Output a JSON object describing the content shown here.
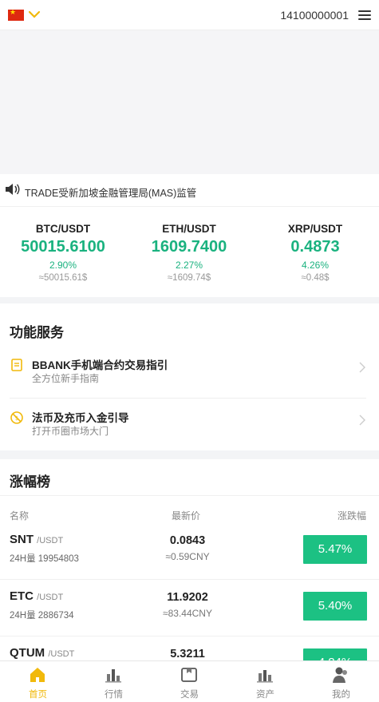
{
  "header": {
    "flag_icon": "china-flag-icon",
    "dropdown_icon": "chevron-down-icon",
    "phone": "14100000001",
    "menu_icon": "hamburger-menu-icon"
  },
  "notice": {
    "icon": "speaker-icon",
    "text": "TRADE受新加坡金融管理局(MAS)监管"
  },
  "tickers": [
    {
      "pair": "BTC/USDT",
      "price": "50015.6100",
      "change": "2.90%",
      "approx": "≈50015.61$"
    },
    {
      "pair": "ETH/USDT",
      "price": "1609.7400",
      "change": "2.27%",
      "approx": "≈1609.74$"
    },
    {
      "pair": "XRP/USDT",
      "price": "0.4873",
      "change": "4.26%",
      "approx": "≈0.48$"
    }
  ],
  "services": {
    "title": "功能服务",
    "items": [
      {
        "title": "BBANK手机端合约交易指引",
        "subtitle": "全方位新手指南",
        "icon": "document-icon"
      },
      {
        "title": "法币及充币入金引导",
        "subtitle": "打开币圈市场大门",
        "icon": "currency-exchange-icon"
      }
    ]
  },
  "gainers": {
    "title": "涨幅榜",
    "columns": {
      "name": "名称",
      "last": "最新价",
      "change": "涨跌幅"
    },
    "rows": [
      {
        "coin": "SNT",
        "quote": "/USDT",
        "volume": "24H量 19954803",
        "last": "0.0843",
        "cny": "≈0.59CNY",
        "change": "5.47%"
      },
      {
        "coin": "ETC",
        "quote": "/USDT",
        "volume": "24H量 2886734",
        "last": "11.9202",
        "cny": "≈83.44CNY",
        "change": "5.40%"
      },
      {
        "coin": "QTUM",
        "quote": "/USDT",
        "volume": "",
        "last": "5.3211",
        "cny": "",
        "change": "4.84%"
      }
    ]
  },
  "tabbar": [
    {
      "label": "首页",
      "icon": "home-icon"
    },
    {
      "label": "行情",
      "icon": "market-chart-icon"
    },
    {
      "label": "交易",
      "icon": "trade-icon"
    },
    {
      "label": "资产",
      "icon": "assets-icon"
    },
    {
      "label": "我的",
      "icon": "user-icon"
    }
  ],
  "colors": {
    "accent": "#f1b90b",
    "up_green": "#1ab27f",
    "badge_green": "#1cc183"
  }
}
